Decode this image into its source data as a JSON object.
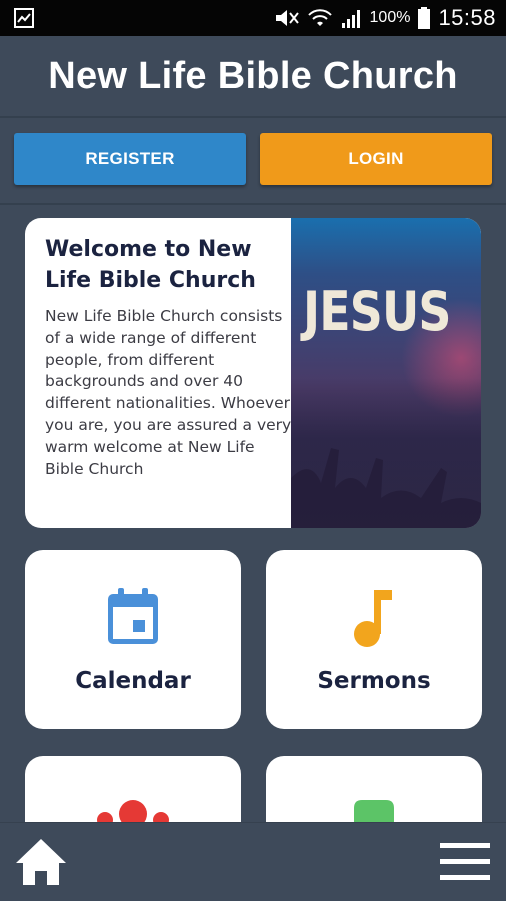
{
  "status_bar": {
    "battery_percent": "100%",
    "time": "15:58"
  },
  "header": {
    "title": "New Life Bible Church"
  },
  "actions": {
    "register_label": "REGISTER",
    "login_label": "LOGIN"
  },
  "welcome_card": {
    "title": "Welcome to New Life Bible Church",
    "body": "New Life Bible Church consists of a wide range of different people, from different backgrounds and over 40 different nationalities. Whoever you are, you are assured a very warm welcome at New Life Bible Church",
    "image_text": "JESUS"
  },
  "tiles": [
    {
      "label": "Calendar",
      "icon": "calendar-icon",
      "color": "#4a90d9"
    },
    {
      "label": "Sermons",
      "icon": "music-note-icon",
      "color": "#f2a51d"
    },
    {
      "label": "",
      "icon": "people-icon",
      "color": "#e53935"
    },
    {
      "label": "",
      "icon": "green-shape-icon",
      "color": "#5cc467"
    }
  ],
  "bottom_nav": {
    "home_icon": "home-icon",
    "menu_icon": "menu-icon"
  },
  "colors": {
    "background": "#3e4a5a",
    "register": "#2f87c9",
    "login": "#f09a1a",
    "title_text": "#1b2340"
  }
}
